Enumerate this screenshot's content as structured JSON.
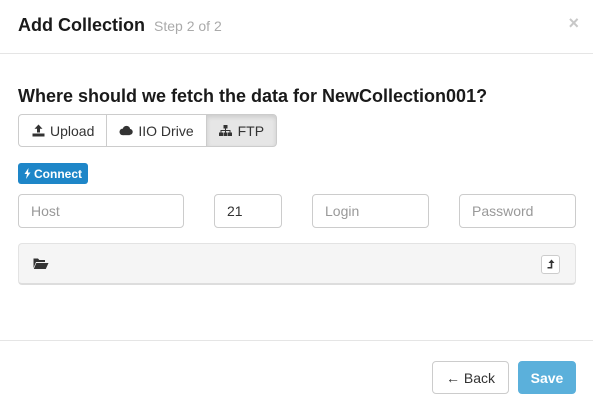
{
  "header": {
    "title": "Add Collection",
    "step": "Step 2 of 2",
    "close_glyph": "×"
  },
  "question": {
    "prefix": "Where should we fetch the data for ",
    "collection_name": "NewCollection001",
    "suffix": "?"
  },
  "source_tabs": [
    {
      "label": "Upload",
      "icon": "upload-icon",
      "active": false
    },
    {
      "label": "IIO Drive",
      "icon": "cloud-icon",
      "active": false
    },
    {
      "label": "FTP",
      "icon": "sitemap-icon",
      "active": true
    }
  ],
  "connect": {
    "label": "Connect",
    "icon": "bolt-icon",
    "color": "#1e86c8"
  },
  "fields": {
    "host": {
      "placeholder": "Host",
      "value": ""
    },
    "port": {
      "placeholder": "",
      "value": "21"
    },
    "login": {
      "placeholder": "Login",
      "value": ""
    },
    "password": {
      "placeholder": "Password",
      "value": ""
    }
  },
  "browser": {
    "folder_icon": "folder-open-icon",
    "upload_icon": "level-up-icon"
  },
  "footer": {
    "back_label": "← Back",
    "save_label": "Save",
    "save_color": "#5bb0db"
  }
}
